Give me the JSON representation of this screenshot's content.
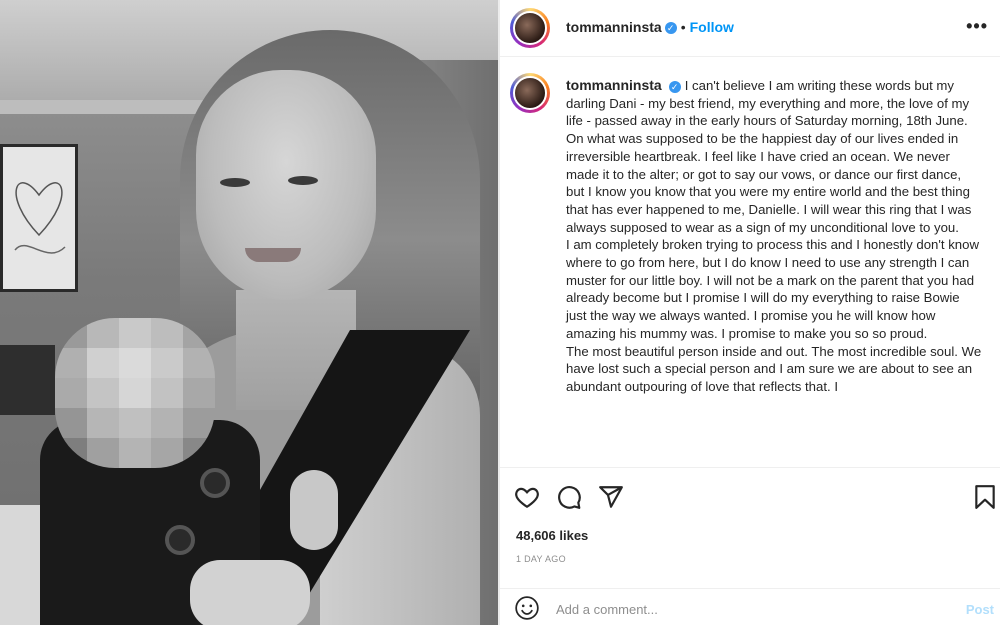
{
  "post": {
    "username": "tommanninsta",
    "follow_label": "Follow",
    "separator": "•",
    "more_label": "•••",
    "verified_glyph": "✓",
    "caption_paragraphs": [
      "I can't believe I am writing these words but my darling Dani - my best friend, my everything and more, the love of my life - passed away in the early hours of Saturday morning, 18th June.",
      "On what was supposed to be the happiest day of our lives ended in irreversible heartbreak. I feel like I have cried an ocean. We never made it to the alter; or got to say our vows, or dance our first dance, but I know you know that you were my entire world and the best thing that has ever happened to me, Danielle. I will wear this ring that I was always supposed to wear as a sign of my unconditional love to you.",
      "I am completely broken trying to process this and I honestly don't know where to go from here, but I do know I need to use any strength I can muster for our little boy. I will not be a mark on the parent that you had already become but I promise I will do my everything to raise Bowie just the way we always wanted. I promise you he will know how amazing his mummy was. I promise to make you so so proud.",
      "The most beautiful person inside and out. The most incredible soul. We have lost such a special person and I am sure we are about to see an abundant outpouring of love that reflects that. I"
    ],
    "likes": "48,606 likes",
    "time_ago": "1 DAY AGO",
    "comment_placeholder": "Add a comment...",
    "post_label": "Post"
  },
  "icons": {
    "like": "heart-icon",
    "comment": "comment-icon",
    "share": "paper-plane-icon",
    "save": "bookmark-icon",
    "emoji": "emoji-icon"
  },
  "colors": {
    "accent": "#0095f6",
    "verified": "#3897f0",
    "text": "#262626",
    "muted": "#8e8e8e",
    "post_disabled": "#b2dffc"
  }
}
